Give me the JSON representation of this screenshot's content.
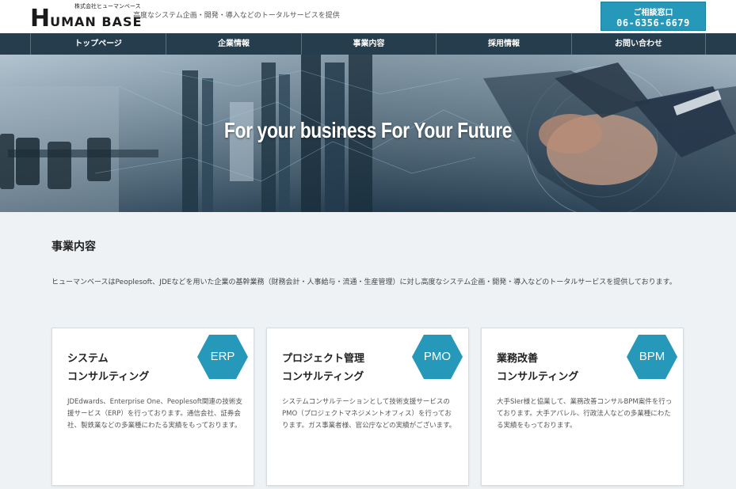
{
  "header": {
    "logo_sub": "株式会社ヒューマンベース",
    "logo_initial": "H",
    "logo_rest": "UMAN BASE",
    "tagline": "高度なシステム企画・開発・導入などのトータルサービスを提供",
    "contact_label": "ご相談窓口",
    "contact_phone": "06-6356-6679"
  },
  "nav": {
    "items": [
      {
        "label": "トップページ"
      },
      {
        "label": "企業情報"
      },
      {
        "label": "事業内容"
      },
      {
        "label": "採用情報"
      },
      {
        "label": "お問い合わせ"
      }
    ]
  },
  "hero": {
    "title": "For your business For Your Future"
  },
  "main": {
    "section_title": "事業内容",
    "intro": "ヒューマンベースはPeoplesoft、JDEなどを用いた企業の基幹業務（財務会計・人事給与・流通・生産管理）に対し高度なシステム企画・開発・導入などのトータルサービスを提供しております。",
    "cards": [
      {
        "title_line1": "システム",
        "title_line2": "コンサルティング",
        "badge": "ERP",
        "desc": "JDEdwards、Enterprise One、Peoplesoft関連の技術支援サービス（ERP）を行っております。通信会社、証券会社、製鉄業などの多業種にわたる実績をもっております。"
      },
      {
        "title_line1": "プロジェクト管理",
        "title_line2": "コンサルティング",
        "badge": "PMO",
        "desc": "システムコンサルテーションとして技術支援サービスのPMO（プロジェクトマネジメントオフィス）を行っております。ガス事業者様、官公庁などの実績がございます。"
      },
      {
        "title_line1": "業務改善",
        "title_line2": "コンサルティング",
        "badge": "BPM",
        "desc": "大手SIer様と協業して、業務改善コンサルBPM案件を行っております。大手アパレル、行政法人などの多業種にわたる実績をもっております。"
      }
    ]
  },
  "colors": {
    "accent": "#2698b9",
    "nav_bg": "#263d4d",
    "content_bg": "#eef2f5"
  }
}
